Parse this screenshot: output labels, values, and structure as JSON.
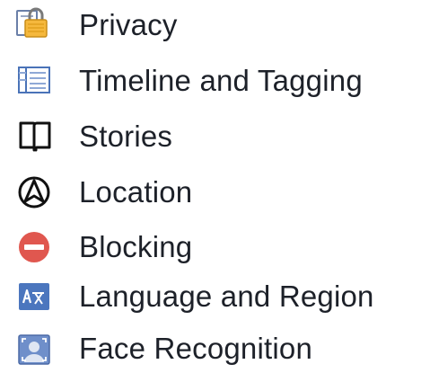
{
  "settings_menu": {
    "items": [
      {
        "label": "Privacy",
        "icon": "lock-icon"
      },
      {
        "label": "Timeline and Tagging",
        "icon": "timeline-icon"
      },
      {
        "label": "Stories",
        "icon": "book-icon"
      },
      {
        "label": "Location",
        "icon": "location-icon"
      },
      {
        "label": "Blocking",
        "icon": "blocking-icon"
      },
      {
        "label": "Language and Region",
        "icon": "language-icon"
      },
      {
        "label": "Face Recognition",
        "icon": "face-recognition-icon"
      }
    ]
  },
  "colors": {
    "text": "#1d2129",
    "lock_body": "#f5b83d",
    "timeline_blue": "#4a73b8",
    "blocking_red": "#e0574f",
    "language_bg": "#4b76be",
    "face_bg": "#6f8fca"
  }
}
